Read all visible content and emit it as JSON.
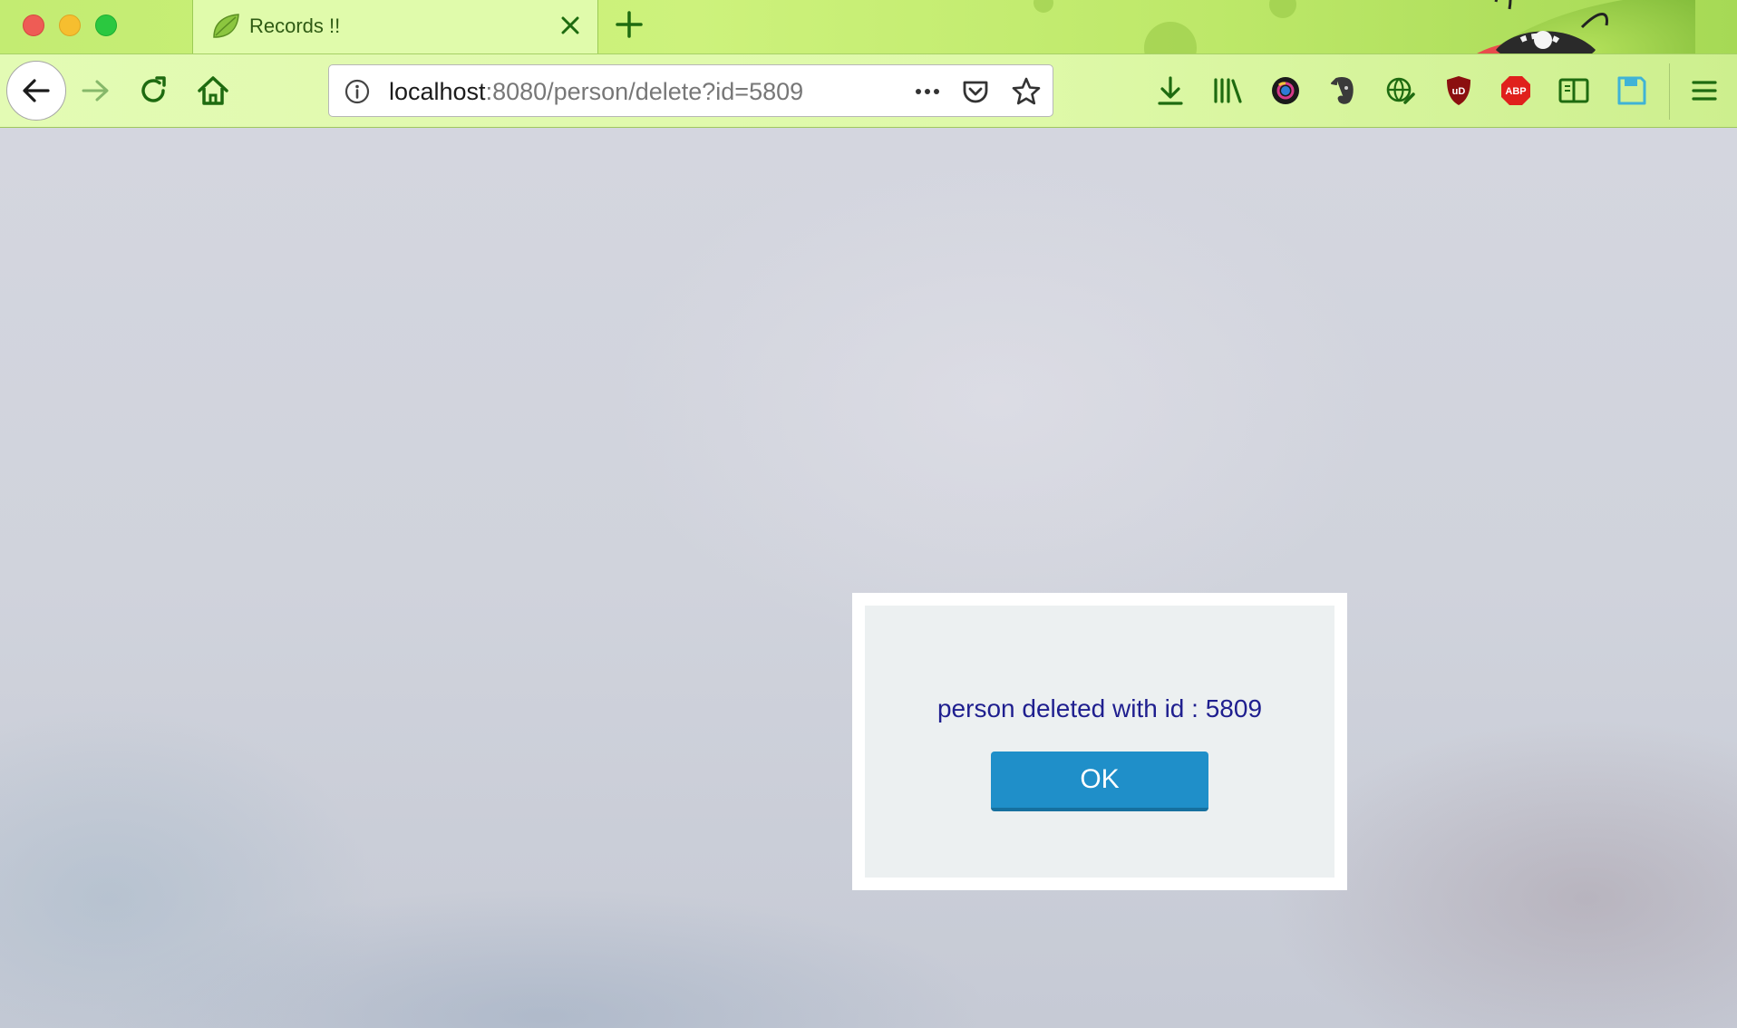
{
  "browser": {
    "tab": {
      "title": "Records !!"
    },
    "url": {
      "host": "localhost",
      "rest": ":8080/person/delete?id=5809"
    },
    "colors": {
      "toolbar": "#def9a8",
      "accent": "#1b7a12"
    }
  },
  "toolbar_icons": [
    "download-icon",
    "library-icon",
    "camera-icon",
    "evernote-icon",
    "translate-icon",
    "ublock-icon",
    "adblock-plus-icon",
    "reader-icon",
    "save-icon",
    "menu-icon"
  ],
  "badges": {
    "ublock": "uD",
    "abp": "ABP"
  },
  "dialog": {
    "message": "person deleted with id : 5809",
    "ok_label": "OK",
    "colors": {
      "button": "#1f8fc9",
      "text": "#1f1f8f"
    }
  }
}
